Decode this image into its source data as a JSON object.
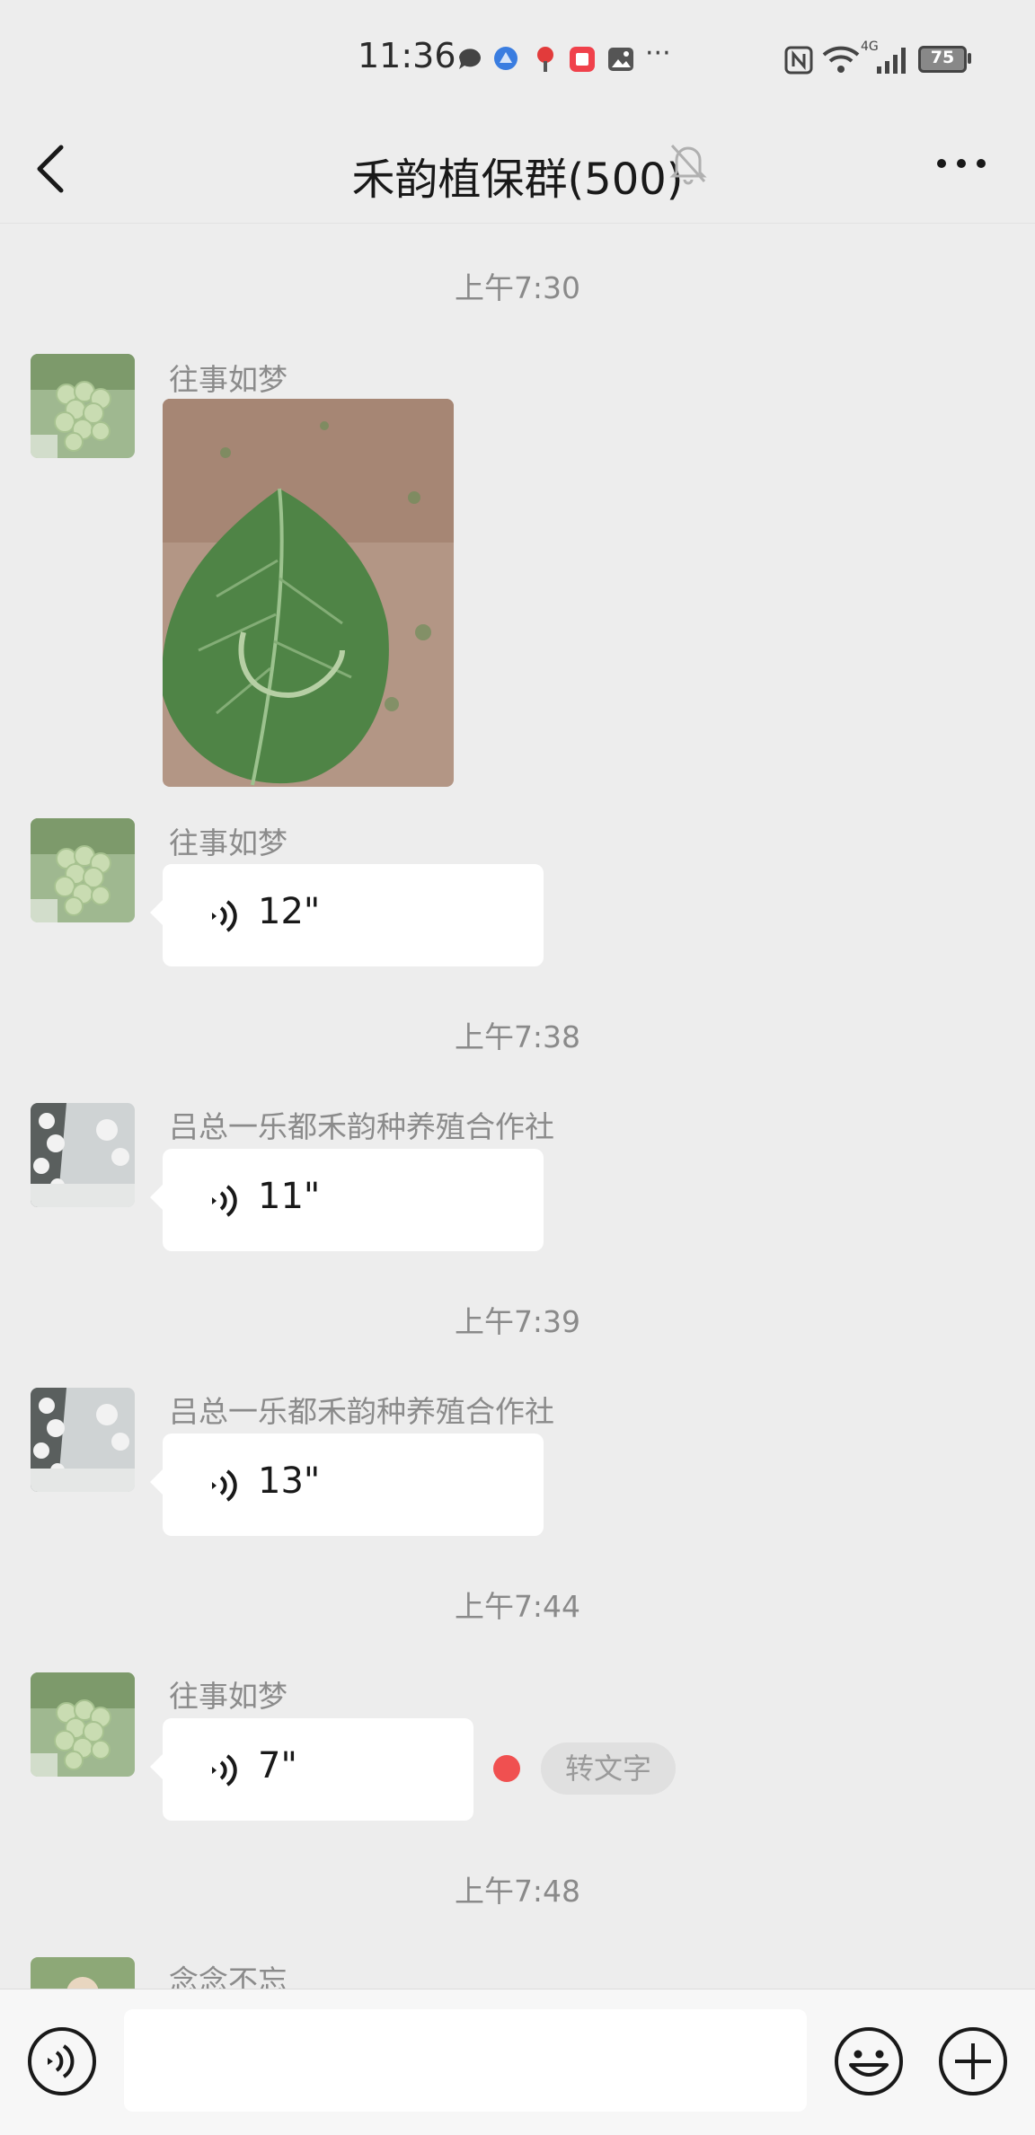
{
  "status_bar": {
    "time": "11:36",
    "network": "4G",
    "battery": "75",
    "more": "···"
  },
  "header": {
    "title": "禾韵植保群(500)"
  },
  "messages": [
    {
      "time": "上午7:30"
    },
    {
      "sender": "往事如梦",
      "type": "image"
    },
    {
      "sender": "往事如梦",
      "type": "voice",
      "duration": "12\""
    },
    {
      "time": "上午7:38"
    },
    {
      "sender": "吕总一乐都禾韵种养殖合作社",
      "type": "voice",
      "duration": "11\""
    },
    {
      "time": "上午7:39"
    },
    {
      "sender": "吕总一乐都禾韵种养殖合作社",
      "type": "voice",
      "duration": "13\""
    },
    {
      "time": "上午7:44"
    },
    {
      "sender": "往事如梦",
      "type": "voice",
      "duration": "7\"",
      "unread": true,
      "action": "转文字"
    },
    {
      "time": "上午7:48"
    },
    {
      "sender": "念念不忘",
      "type": "partial"
    }
  ],
  "colors": {
    "background": "#ededed",
    "bubble": "#ffffff",
    "unread_dot": "#f05050",
    "timestamp": "#8a8a8a"
  },
  "icons": [
    "chat-bubble-icon",
    "browser-icon",
    "map-pin-icon",
    "red-app-icon",
    "gallery-icon",
    "nfc-icon",
    "wifi-icon",
    "signal-icon",
    "battery-icon",
    "back-icon",
    "mute-bell-icon",
    "more-icon",
    "voice-wave-icon",
    "voice-input-icon",
    "emoji-icon",
    "plus-icon"
  ]
}
